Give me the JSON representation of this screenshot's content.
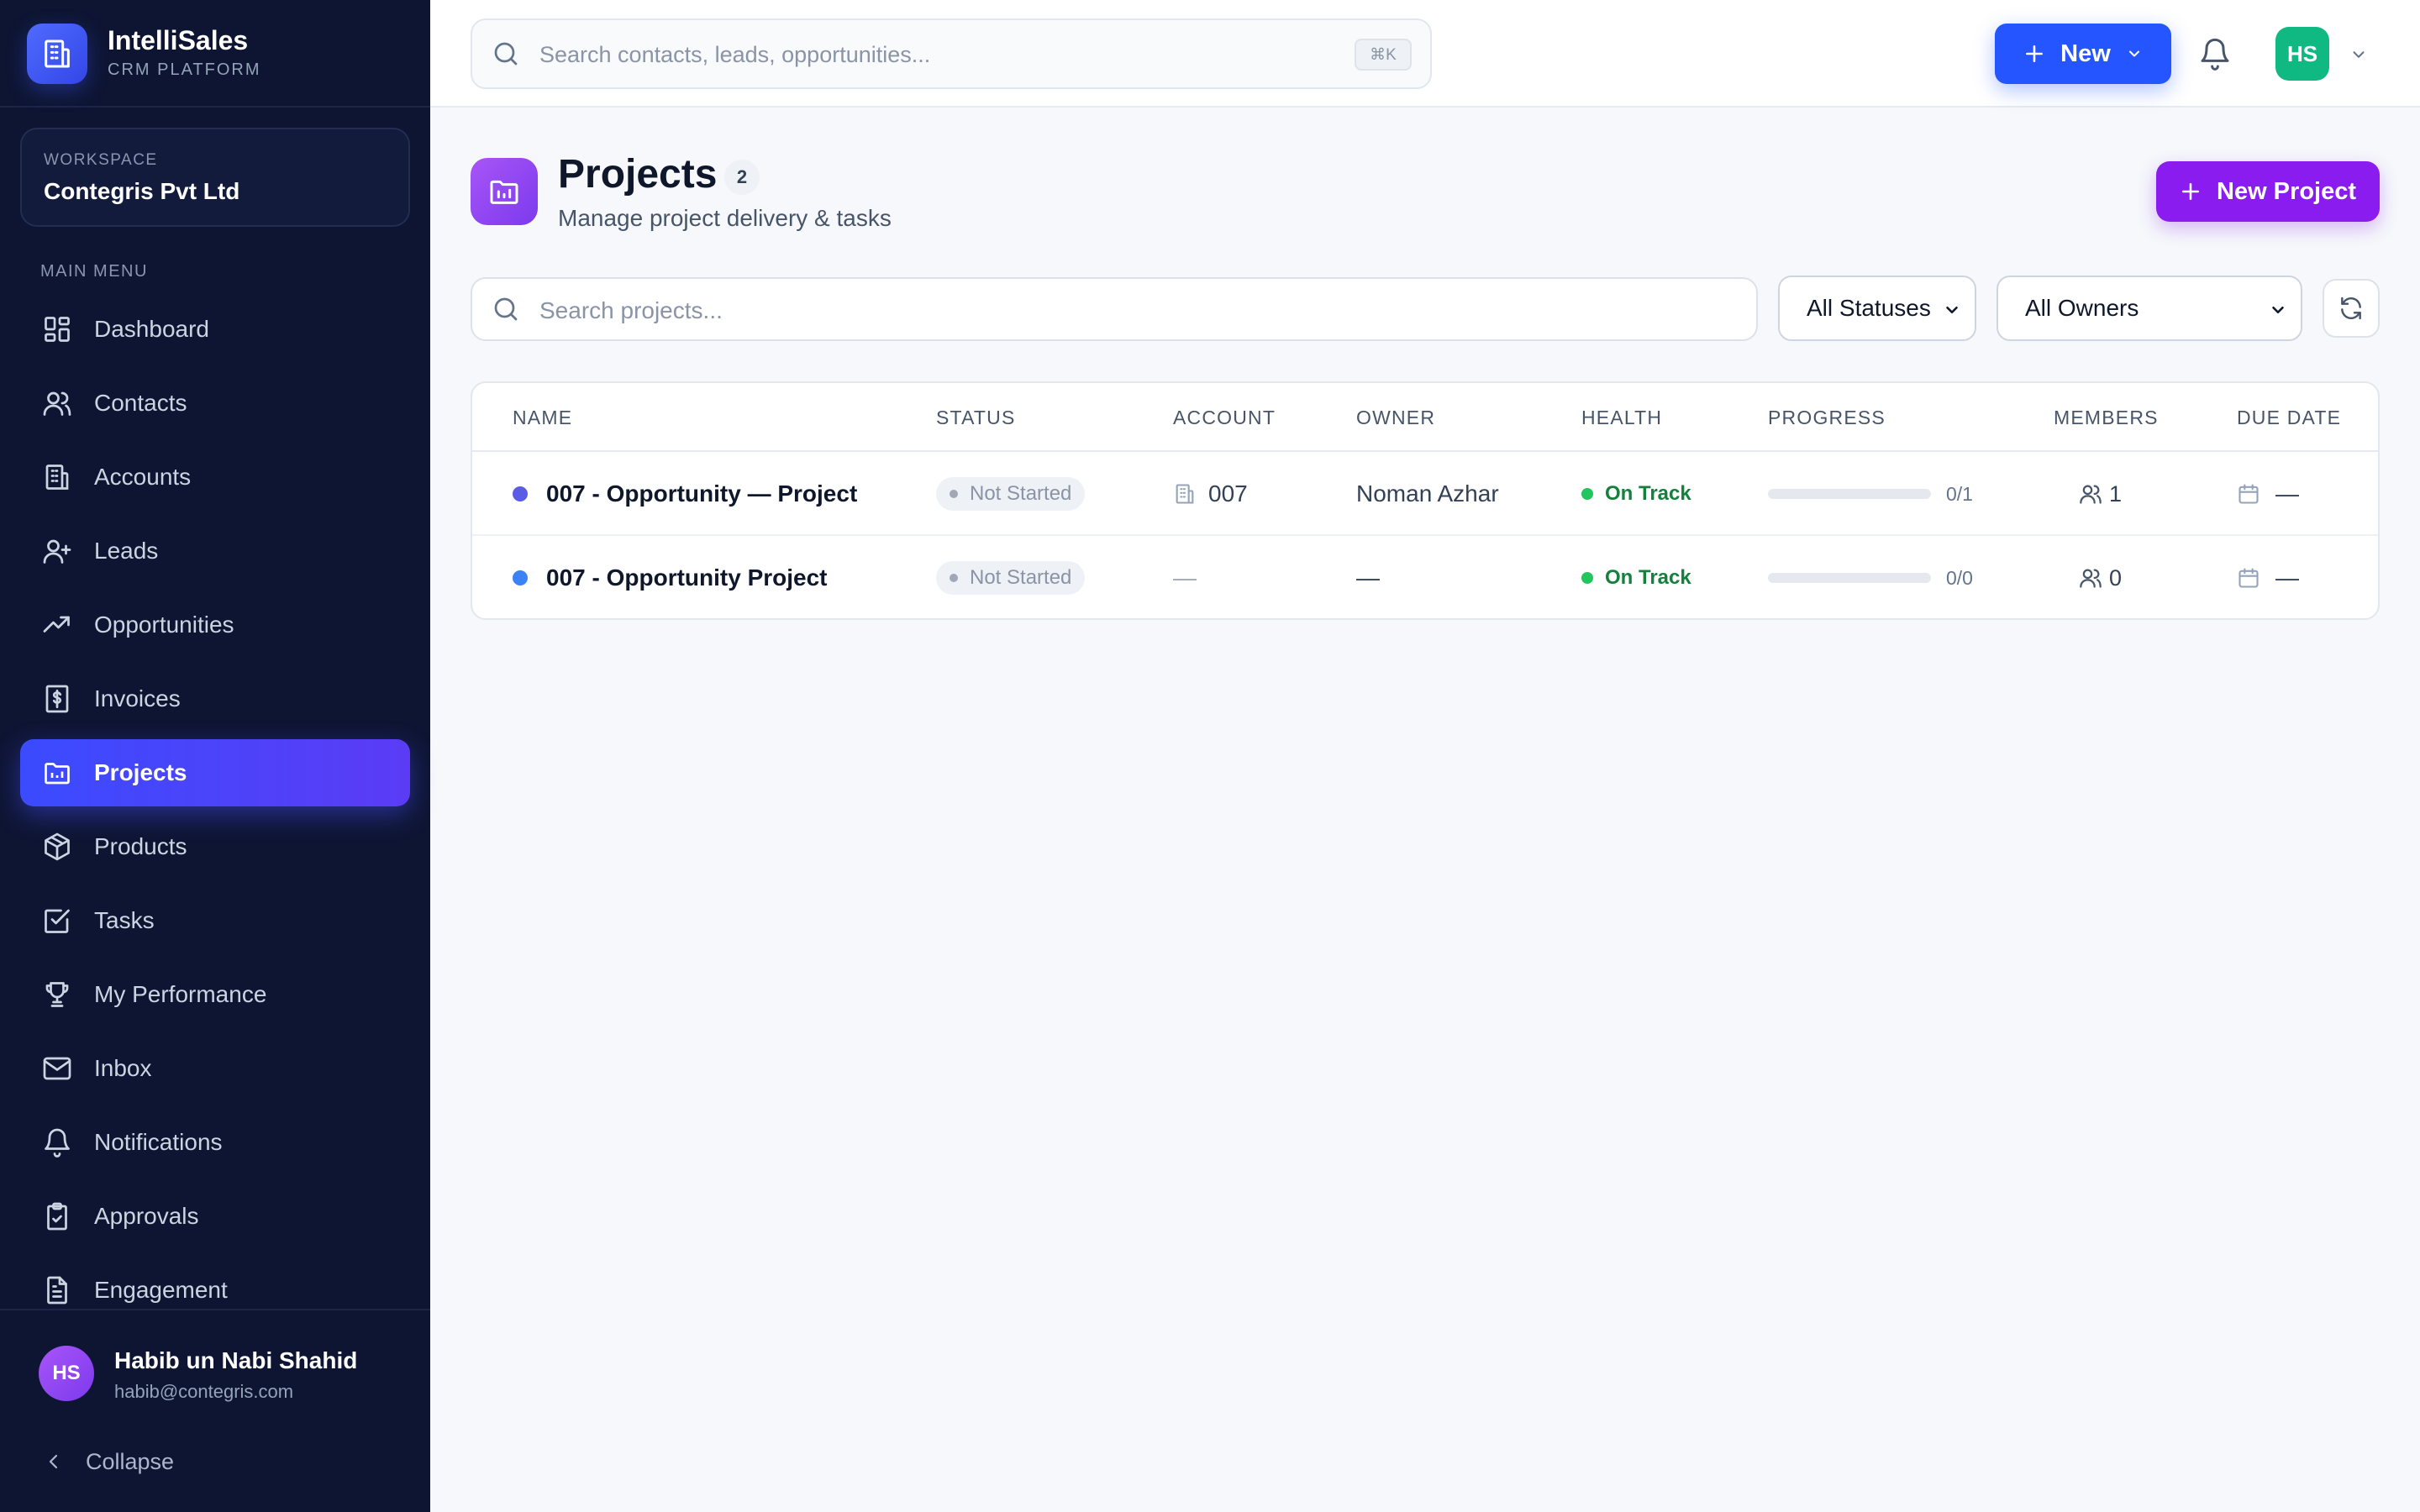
{
  "brand": {
    "name": "IntelliSales",
    "subtitle": "CRM PLATFORM",
    "logo_icon": "building-icon",
    "accent": "#3b4bff"
  },
  "workspace": {
    "label": "WORKSPACE",
    "name": "Contegris Pvt Ltd"
  },
  "sidebar": {
    "heading": "MAIN MENU",
    "items": [
      {
        "label": "Dashboard",
        "icon": "dashboard-icon",
        "active": false
      },
      {
        "label": "Contacts",
        "icon": "users-icon",
        "active": false
      },
      {
        "label": "Accounts",
        "icon": "building-icon",
        "active": false
      },
      {
        "label": "Leads",
        "icon": "user-plus-icon",
        "active": false
      },
      {
        "label": "Opportunities",
        "icon": "trending-up-icon",
        "active": false
      },
      {
        "label": "Invoices",
        "icon": "dollar-receipt-icon",
        "active": false
      },
      {
        "label": "Projects",
        "icon": "folder-icon",
        "active": true
      },
      {
        "label": "Products",
        "icon": "package-icon",
        "active": false
      },
      {
        "label": "Tasks",
        "icon": "check-square-icon",
        "active": false
      },
      {
        "label": "My Performance",
        "icon": "trophy-icon",
        "active": false
      },
      {
        "label": "Inbox",
        "icon": "mail-icon",
        "active": false
      },
      {
        "label": "Notifications",
        "icon": "bell-icon",
        "active": false
      },
      {
        "label": "Approvals",
        "icon": "clipboard-check-icon",
        "active": false
      },
      {
        "label": "Engagement",
        "icon": "file-text-icon",
        "active": false
      }
    ],
    "user": {
      "initials": "HS",
      "name": "Habib un Nabi Shahid",
      "email": "habib@contegris.com"
    },
    "collapse_label": "Collapse"
  },
  "topbar": {
    "search_placeholder": "Search contacts, leads, opportunities...",
    "shortcut": "⌘K",
    "new_label": "New",
    "avatar_initials": "HS",
    "new_button_color": "#2455ff",
    "avatar_color": "#10b981"
  },
  "page": {
    "title": "Projects",
    "count": "2",
    "subtitle": "Manage project delivery & tasks",
    "new_project_label": "New Project",
    "new_project_color": "#8b1cf0"
  },
  "filters": {
    "search_placeholder": "Search projects...",
    "status_selected": "All Statuses",
    "owner_selected": "All Owners"
  },
  "table": {
    "columns": [
      "NAME",
      "STATUS",
      "ACCOUNT",
      "OWNER",
      "HEALTH",
      "PROGRESS",
      "MEMBERS",
      "DUE DATE"
    ],
    "rows": [
      {
        "name": "007 - Opportunity — Project",
        "dot_color": "#5b5ce6",
        "status": "Not Started",
        "account": "007",
        "has_account": true,
        "owner": "Noman Azhar",
        "owner_muted": false,
        "health": "On Track",
        "progress_text": "0/1",
        "progress_fraction": 0,
        "members": "1",
        "due": "—"
      },
      {
        "name": "007 - Opportunity Project",
        "dot_color": "#3b82f6",
        "status": "Not Started",
        "account": "—",
        "has_account": false,
        "owner": "—",
        "owner_muted": false,
        "health": "On Track",
        "progress_text": "0/0",
        "progress_fraction": 0,
        "members": "0",
        "due": "—"
      }
    ]
  }
}
